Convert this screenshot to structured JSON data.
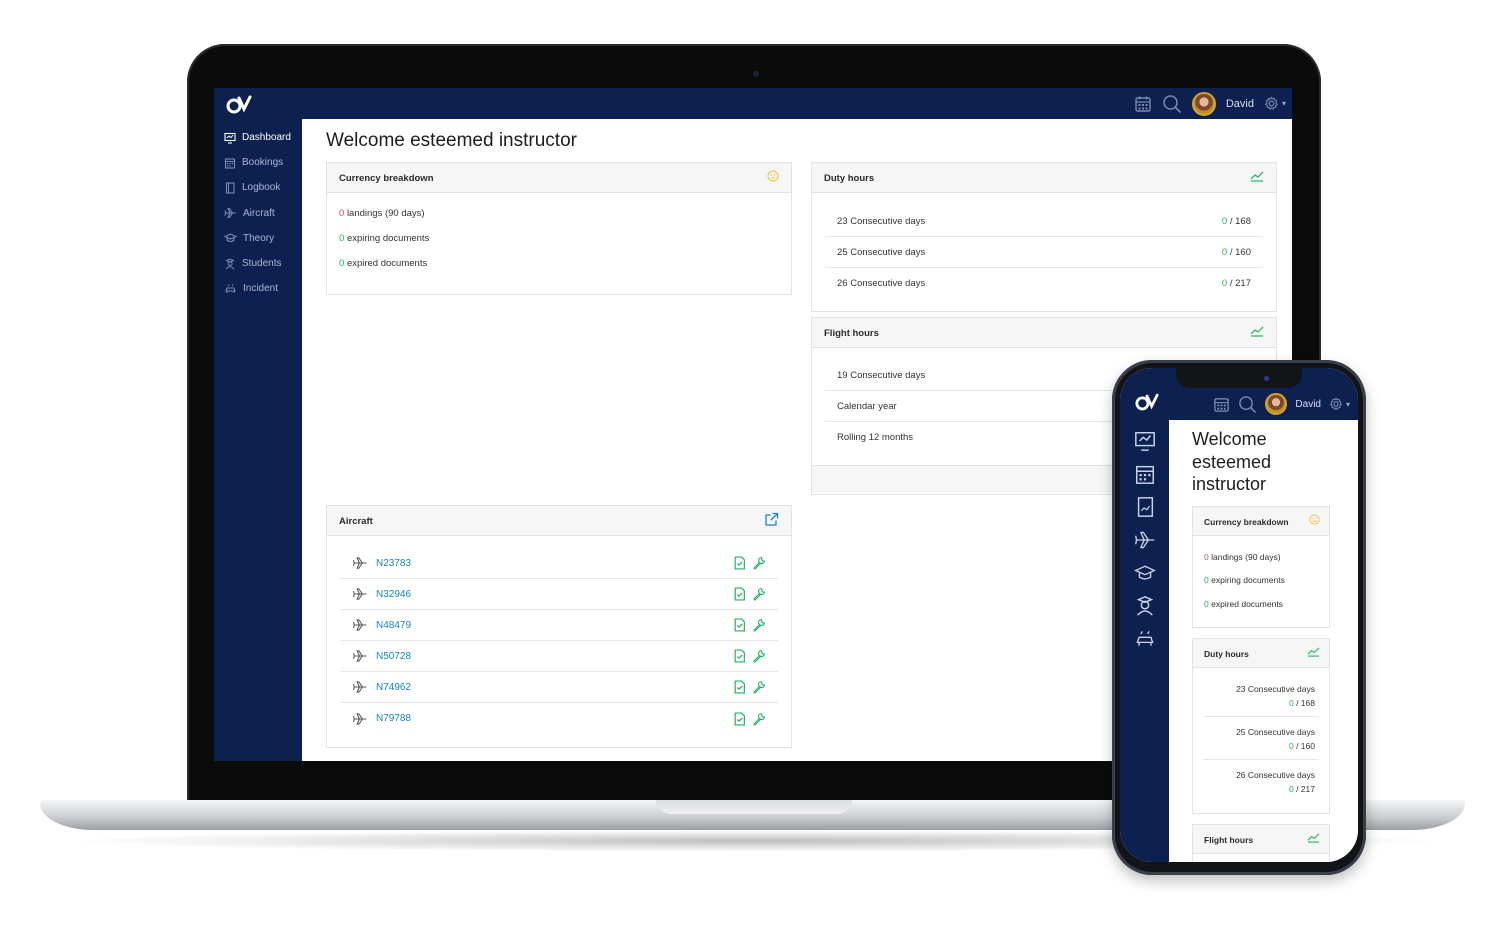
{
  "app": {
    "user_name": "David"
  },
  "sidebar": {
    "items": [
      {
        "label": "Dashboard",
        "icon": "dashboard-icon",
        "active": true
      },
      {
        "label": "Bookings",
        "icon": "calendar-icon"
      },
      {
        "label": "Logbook",
        "icon": "logbook-icon"
      },
      {
        "label": "Aircraft",
        "icon": "airplane-icon"
      },
      {
        "label": "Theory",
        "icon": "graduation-cap-icon"
      },
      {
        "label": "Students",
        "icon": "student-icon"
      },
      {
        "label": "Incident",
        "icon": "incident-icon"
      }
    ]
  },
  "main": {
    "title": "Welcome esteemed instructor",
    "currency": {
      "title": "Currency breakdown",
      "rows": [
        {
          "count": "0",
          "text": "landings (90 days)",
          "color": "#e5484d"
        },
        {
          "count": "0",
          "text": "expiring documents",
          "color": "#1db45c"
        },
        {
          "count": "0",
          "text": "expired documents",
          "color": "#1db45c"
        }
      ]
    },
    "duty_hours": {
      "title": "Duty hours",
      "rows": [
        {
          "label": "23 Consecutive days",
          "value": "0",
          "limit": " / 168"
        },
        {
          "label": "25 Consecutive days",
          "value": "0",
          "limit": " / 160"
        },
        {
          "label": "26 Consecutive days",
          "value": "0",
          "limit": " / 217"
        }
      ]
    },
    "flight_hours": {
      "title": "Flight hours",
      "rows": [
        {
          "label": "19 Consecutive days"
        },
        {
          "label": "Calendar year"
        },
        {
          "label": "Rolling 12 months"
        }
      ]
    },
    "aircraft": {
      "title": "Aircraft",
      "items": [
        "N23783",
        "N32946",
        "N48479",
        "N50728",
        "N74962",
        "N79788"
      ]
    }
  },
  "mobile": {
    "user_name": "David",
    "title_lines": [
      "Welcome",
      "esteemed",
      "instructor"
    ],
    "currency_title": "Currency breakdown",
    "duty_title": "Duty hours",
    "flight_title": "Flight hours"
  },
  "colors": {
    "navy": "#0d2151",
    "accent_green": "#1db45c",
    "accent_red": "#e5484d",
    "link_blue": "#1583c9",
    "warning_yellow": "#f2c230"
  }
}
